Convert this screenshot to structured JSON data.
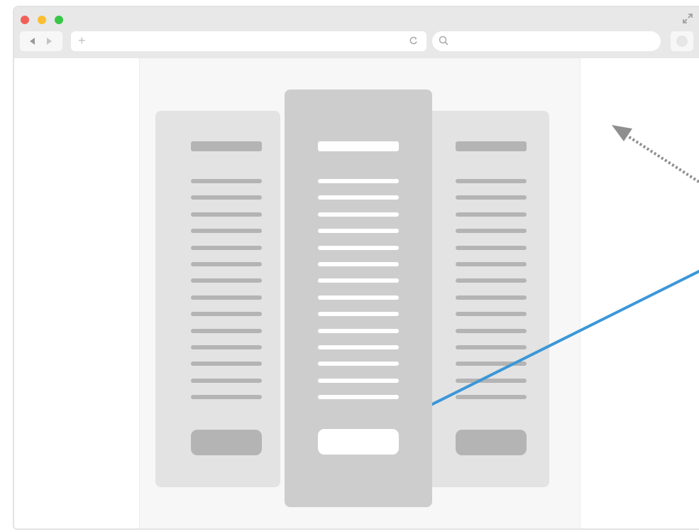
{
  "browser": {
    "window_controls": [
      "close",
      "minimize",
      "maximize"
    ],
    "nav_icons": [
      "back-icon",
      "forward-icon"
    ],
    "address_bar": {
      "icon": "plus-icon",
      "text": "",
      "reload_icon": "reload-icon"
    },
    "search_box": {
      "icon": "search-icon",
      "text": ""
    },
    "extension_icon": "extension-icon",
    "fullscreen_icon": "expand-icon"
  },
  "pricing_columns": [
    {
      "id": "left",
      "emphasized": false,
      "feature_lines": 14,
      "button_style": "filled"
    },
    {
      "id": "center",
      "emphasized": true,
      "feature_lines": 14,
      "button_style": "outline",
      "button_highlighted": true
    },
    {
      "id": "right",
      "emphasized": false,
      "feature_lines": 14,
      "button_style": "filled"
    }
  ],
  "annotations": [
    {
      "type": "dotted-arrow",
      "meaning": "scroll-up hint"
    },
    {
      "type": "pointer-line",
      "target": "center-column-button"
    }
  ],
  "colors": {
    "accent": "#3b97d8",
    "arrow_gray": "#8f8f8f",
    "card_gray": "#e3e3e3",
    "card_emphasized": "#cdcdcd",
    "placeholder_dark": "#b4b4b4",
    "placeholder_light": "#ffffff",
    "traffic_red": "#f25f58",
    "traffic_yellow": "#fbbe2e",
    "traffic_green": "#37c648"
  }
}
